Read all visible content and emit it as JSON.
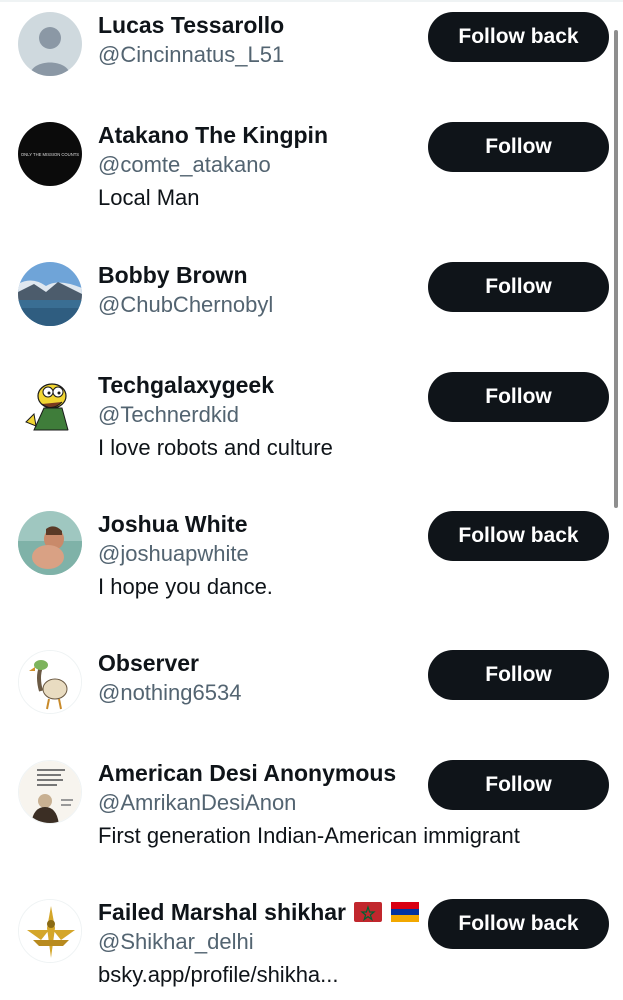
{
  "accounts": [
    {
      "name": "Lucas Tessarollo",
      "handle": "@Cincinnatus_L51",
      "bio": "",
      "button": "Follow back",
      "avatar": "default-avatar-icon"
    },
    {
      "name": "Atakano The Kingpin",
      "handle": "@comte_atakano",
      "bio": "Local Man",
      "button": "Follow",
      "avatar": "black-banner-avatar",
      "avatar_text": "ONLY THE MISSION COUNTS"
    },
    {
      "name": "Bobby Brown",
      "handle": "@ChubChernobyl",
      "bio": "",
      "button": "Follow",
      "avatar": "mountain-lake-avatar"
    },
    {
      "name": "Techgalaxygeek",
      "handle": "@Technerdkid",
      "bio": "I love robots and culture",
      "button": "Follow",
      "avatar": "cartoon-character-avatar"
    },
    {
      "name": "Joshua White",
      "handle": "@joshuapwhite",
      "bio": "I hope you dance.",
      "button": "Follow back",
      "avatar": "beach-photo-avatar"
    },
    {
      "name": "Observer",
      "handle": "@nothing6534",
      "bio": "",
      "button": "Follow",
      "avatar": "cartoon-bird-avatar"
    },
    {
      "name": "American Desi Anonymous",
      "handle": "@AmrikanDesiAnon",
      "bio": "First generation Indian-American immigrant",
      "button": "Follow",
      "avatar": "quote-portrait-avatar"
    },
    {
      "name": "Failed Marshal shikhar",
      "handle": "@Shikhar_delhi",
      "bio": "bsky.app/profile/shikha...",
      "button": "Follow back",
      "avatar": "gold-emblem-avatar",
      "name_flags": [
        "morocco-flag-icon",
        "armenia-flag-icon"
      ]
    }
  ],
  "colors": {
    "button_bg": "#0f1419",
    "button_text": "#ffffff",
    "handle_text": "#536471",
    "primary_text": "#0f1419"
  }
}
